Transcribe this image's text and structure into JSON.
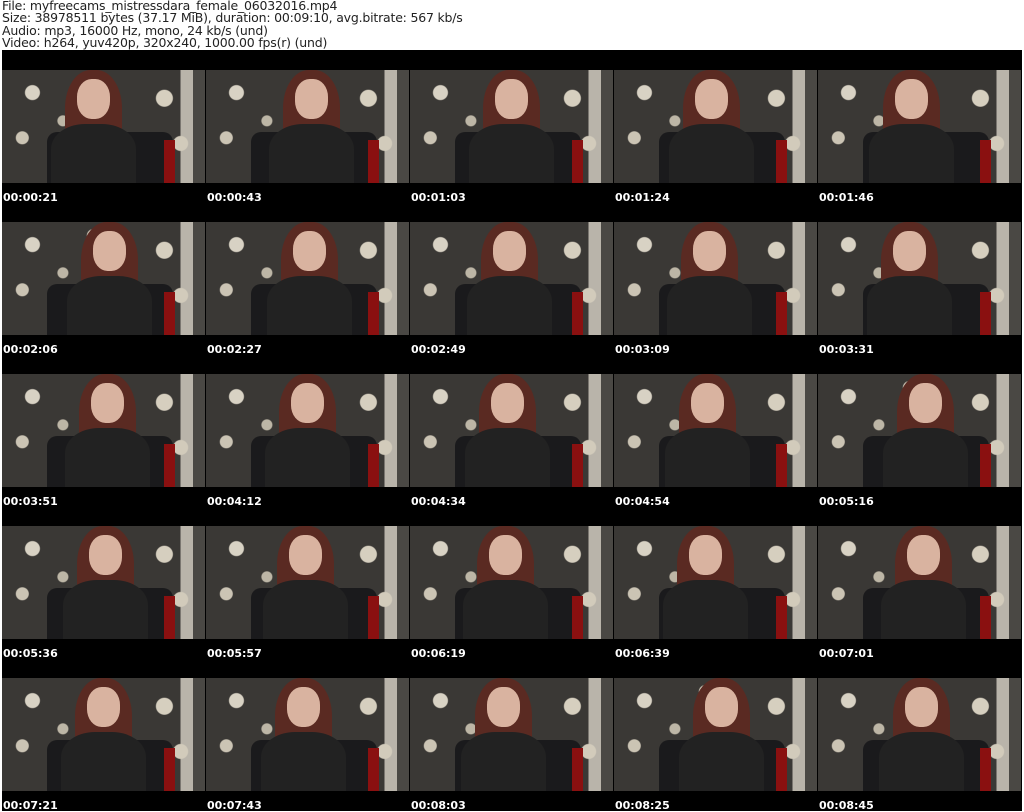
{
  "header": {
    "file": "File: myfreecams_mistressdara_female_06032016.mp4",
    "size": "Size: 38978511 bytes (37.17 MiB), duration: 00:09:10, avg.bitrate: 567 kb/s",
    "audio": "Audio: mp3, 16000 Hz, mono, 24 kb/s (und)",
    "video": "Video: h264, yuv420p, 320x240, 1000.00 fps(r) (und)"
  },
  "timestamps": [
    "00:00:21",
    "00:00:43",
    "00:01:03",
    "00:01:24",
    "00:01:46",
    "00:02:06",
    "00:02:27",
    "00:02:49",
    "00:03:09",
    "00:03:31",
    "00:03:51",
    "00:04:12",
    "00:04:34",
    "00:04:54",
    "00:05:16",
    "00:05:36",
    "00:05:57",
    "00:06:19",
    "00:06:39",
    "00:07:01",
    "00:07:21",
    "00:07:43",
    "00:08:03",
    "00:08:25",
    "00:08:45"
  ]
}
